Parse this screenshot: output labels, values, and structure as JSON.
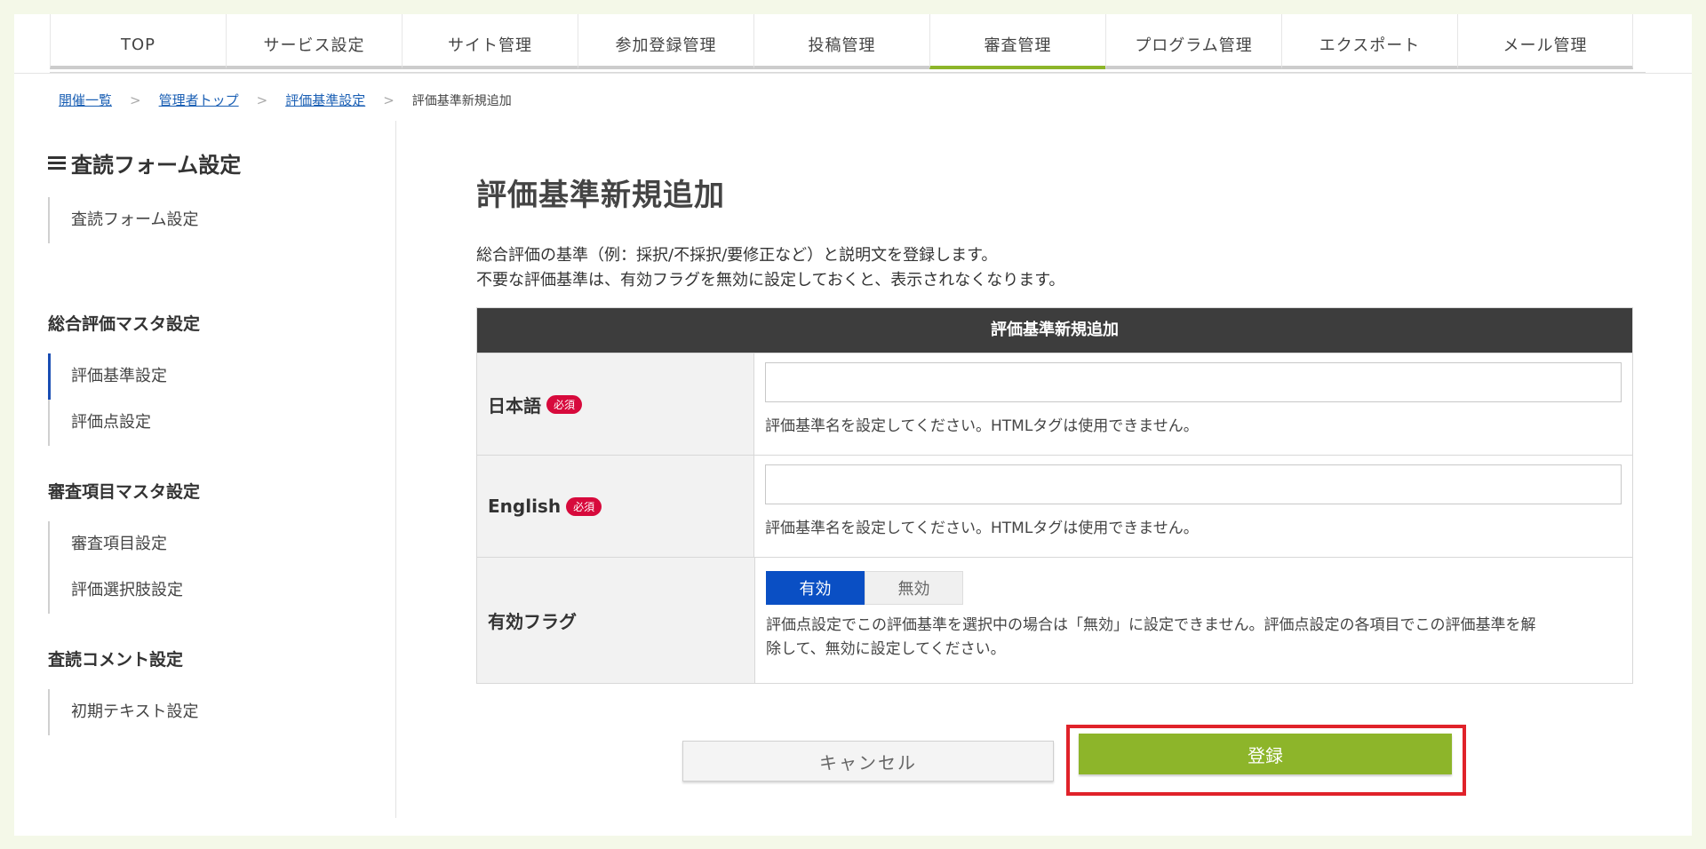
{
  "nav": {
    "items": [
      {
        "label": "TOP"
      },
      {
        "label": "サービス設定"
      },
      {
        "label": "サイト管理"
      },
      {
        "label": "参加登録管理"
      },
      {
        "label": "投稿管理"
      },
      {
        "label": "審査管理",
        "active": true
      },
      {
        "label": "プログラム管理"
      },
      {
        "label": "エクスポート"
      },
      {
        "label": "メール管理"
      }
    ]
  },
  "breadcrumb": {
    "items": [
      "開催一覧",
      "管理者トップ",
      "評価基準設定"
    ],
    "current": "評価基準新規追加",
    "separator": ">"
  },
  "sidebar": {
    "title": "査読フォーム設定",
    "group1": {
      "items": [
        "査読フォーム設定"
      ]
    },
    "heading2": "総合評価マスタ設定",
    "group2": {
      "items": [
        "評価基準設定",
        "評価点設定"
      ]
    },
    "heading3": "審査項目マスタ設定",
    "group3": {
      "items": [
        "審査項目設定",
        "評価選択肢設定"
      ]
    },
    "heading4": "査読コメント設定",
    "group4": {
      "items": [
        "初期テキスト設定"
      ]
    }
  },
  "main": {
    "title": "評価基準新規追加",
    "desc_line1": "総合評価の基準（例：採択/不採択/要修正など）と説明文を登録します。",
    "desc_line2": "不要な評価基準は、有効フラグを無効に設定しておくと、表示されなくなります。",
    "form": {
      "header": "評価基準新規追加",
      "required_badge": "必須",
      "japanese": {
        "label": "日本語",
        "value": "",
        "hint": "評価基準名を設定してください。HTMLタグは使用できません。"
      },
      "english": {
        "label": "English",
        "value": "",
        "hint": "評価基準名を設定してください。HTMLタグは使用できません。"
      },
      "flag": {
        "label": "有効フラグ",
        "on_label": "有効",
        "off_label": "無効",
        "selected": "有効",
        "hint_line1": "評価点設定でこの評価基準を選択中の場合は「無効」に設定できません。評価点設定の各項目でこの評価基準を解",
        "hint_line2": "除して、無効に設定してください。"
      }
    },
    "cancel_label": "キャンセル",
    "submit_label": "登録"
  },
  "colors": {
    "accent_green": "#8db52a",
    "toggle_blue": "#0a4fc4",
    "required_red": "#d70a3c",
    "highlight_red": "#e0222a",
    "header_dark": "#3d3d3d"
  }
}
